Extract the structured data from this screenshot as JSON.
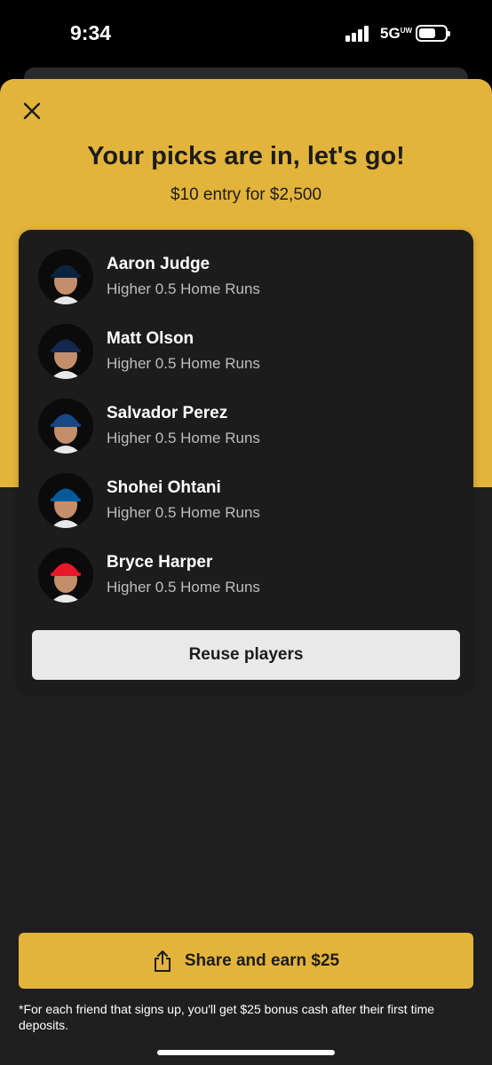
{
  "status_bar": {
    "time": "9:34",
    "network": "5G",
    "network_sub": "UW"
  },
  "header": {
    "title": "Your picks are in, let's go!",
    "subtitle": "$10 entry for $2,500"
  },
  "colors": {
    "accent": "#e3b43c",
    "sheet_bg": "#1f1f1f",
    "card_bg": "#1c1c1c",
    "reuse_bg": "#e9e9e9"
  },
  "picks": [
    {
      "name": "Aaron Judge",
      "line": "Higher 0.5 Home Runs",
      "team_icon": "yankees-cap-icon",
      "cap_color": "#0c2340"
    },
    {
      "name": "Matt Olson",
      "line": "Higher 0.5 Home Runs",
      "team_icon": "braves-cap-icon",
      "cap_color": "#13274f"
    },
    {
      "name": "Salvador Perez",
      "line": "Higher 0.5 Home Runs",
      "team_icon": "royals-cap-icon",
      "cap_color": "#174885"
    },
    {
      "name": "Shohei Ohtani",
      "line": "Higher 0.5 Home Runs",
      "team_icon": "dodgers-cap-icon",
      "cap_color": "#005a9c"
    },
    {
      "name": "Bryce Harper",
      "line": "Higher 0.5 Home Runs",
      "team_icon": "phillies-cap-icon",
      "cap_color": "#e81828"
    }
  ],
  "reuse_button": {
    "label": "Reuse players"
  },
  "share_button": {
    "label": "Share and earn $25"
  },
  "footnote": "*For each friend that signs up, you'll get $25 bonus cash after their first time deposits."
}
